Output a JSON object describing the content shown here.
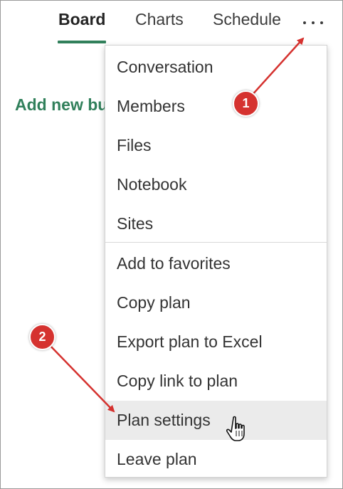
{
  "tabs": [
    {
      "label": "Board",
      "active": true
    },
    {
      "label": "Charts",
      "active": false
    },
    {
      "label": "Schedule",
      "active": false
    }
  ],
  "more_icon": "ellipsis-icon",
  "add_bucket_label": "Add new bucket",
  "menu": {
    "group1": [
      "Conversation",
      "Members",
      "Files",
      "Notebook",
      "Sites"
    ],
    "group2": [
      "Add to favorites",
      "Copy plan",
      "Export plan to Excel",
      "Copy link to plan",
      "Plan settings",
      "Leave plan"
    ],
    "hovered": "Plan settings"
  },
  "annotations": {
    "badge1": "1",
    "badge2": "2"
  },
  "colors": {
    "accent": "#31805b",
    "badge": "#d5322f",
    "arrow": "#d5322f",
    "hover": "#ebebeb"
  }
}
